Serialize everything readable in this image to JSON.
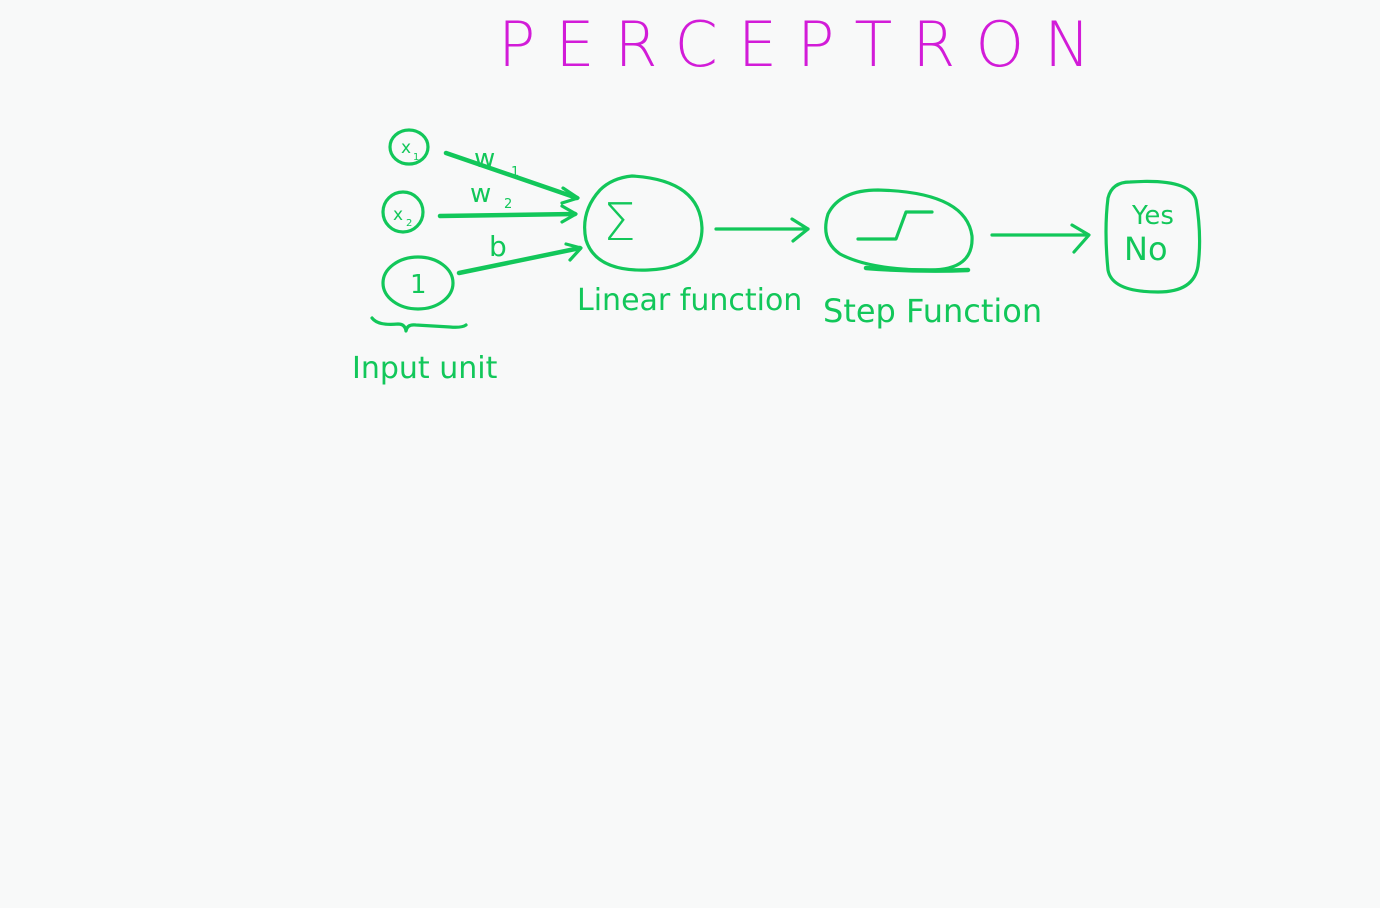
{
  "title": "PERCEPTRON",
  "colors": {
    "background": "#f8f9f9",
    "title": "#d21cd8",
    "ink": "#12c75a"
  },
  "inputs": [
    {
      "label": "x",
      "subscript": "1"
    },
    {
      "label": "x",
      "subscript": "2"
    },
    {
      "label": "1",
      "subscript": ""
    }
  ],
  "weights": [
    {
      "label": "w",
      "subscript": "1"
    },
    {
      "label": "w",
      "subscript": "2"
    },
    {
      "label": "b",
      "subscript": ""
    }
  ],
  "input_group_label": "Input unit",
  "sum_node": {
    "symbol": "Σ",
    "caption": "Linear function"
  },
  "step_node": {
    "caption": "Step Function"
  },
  "output_node": {
    "line1": "Yes",
    "line2": "No"
  }
}
